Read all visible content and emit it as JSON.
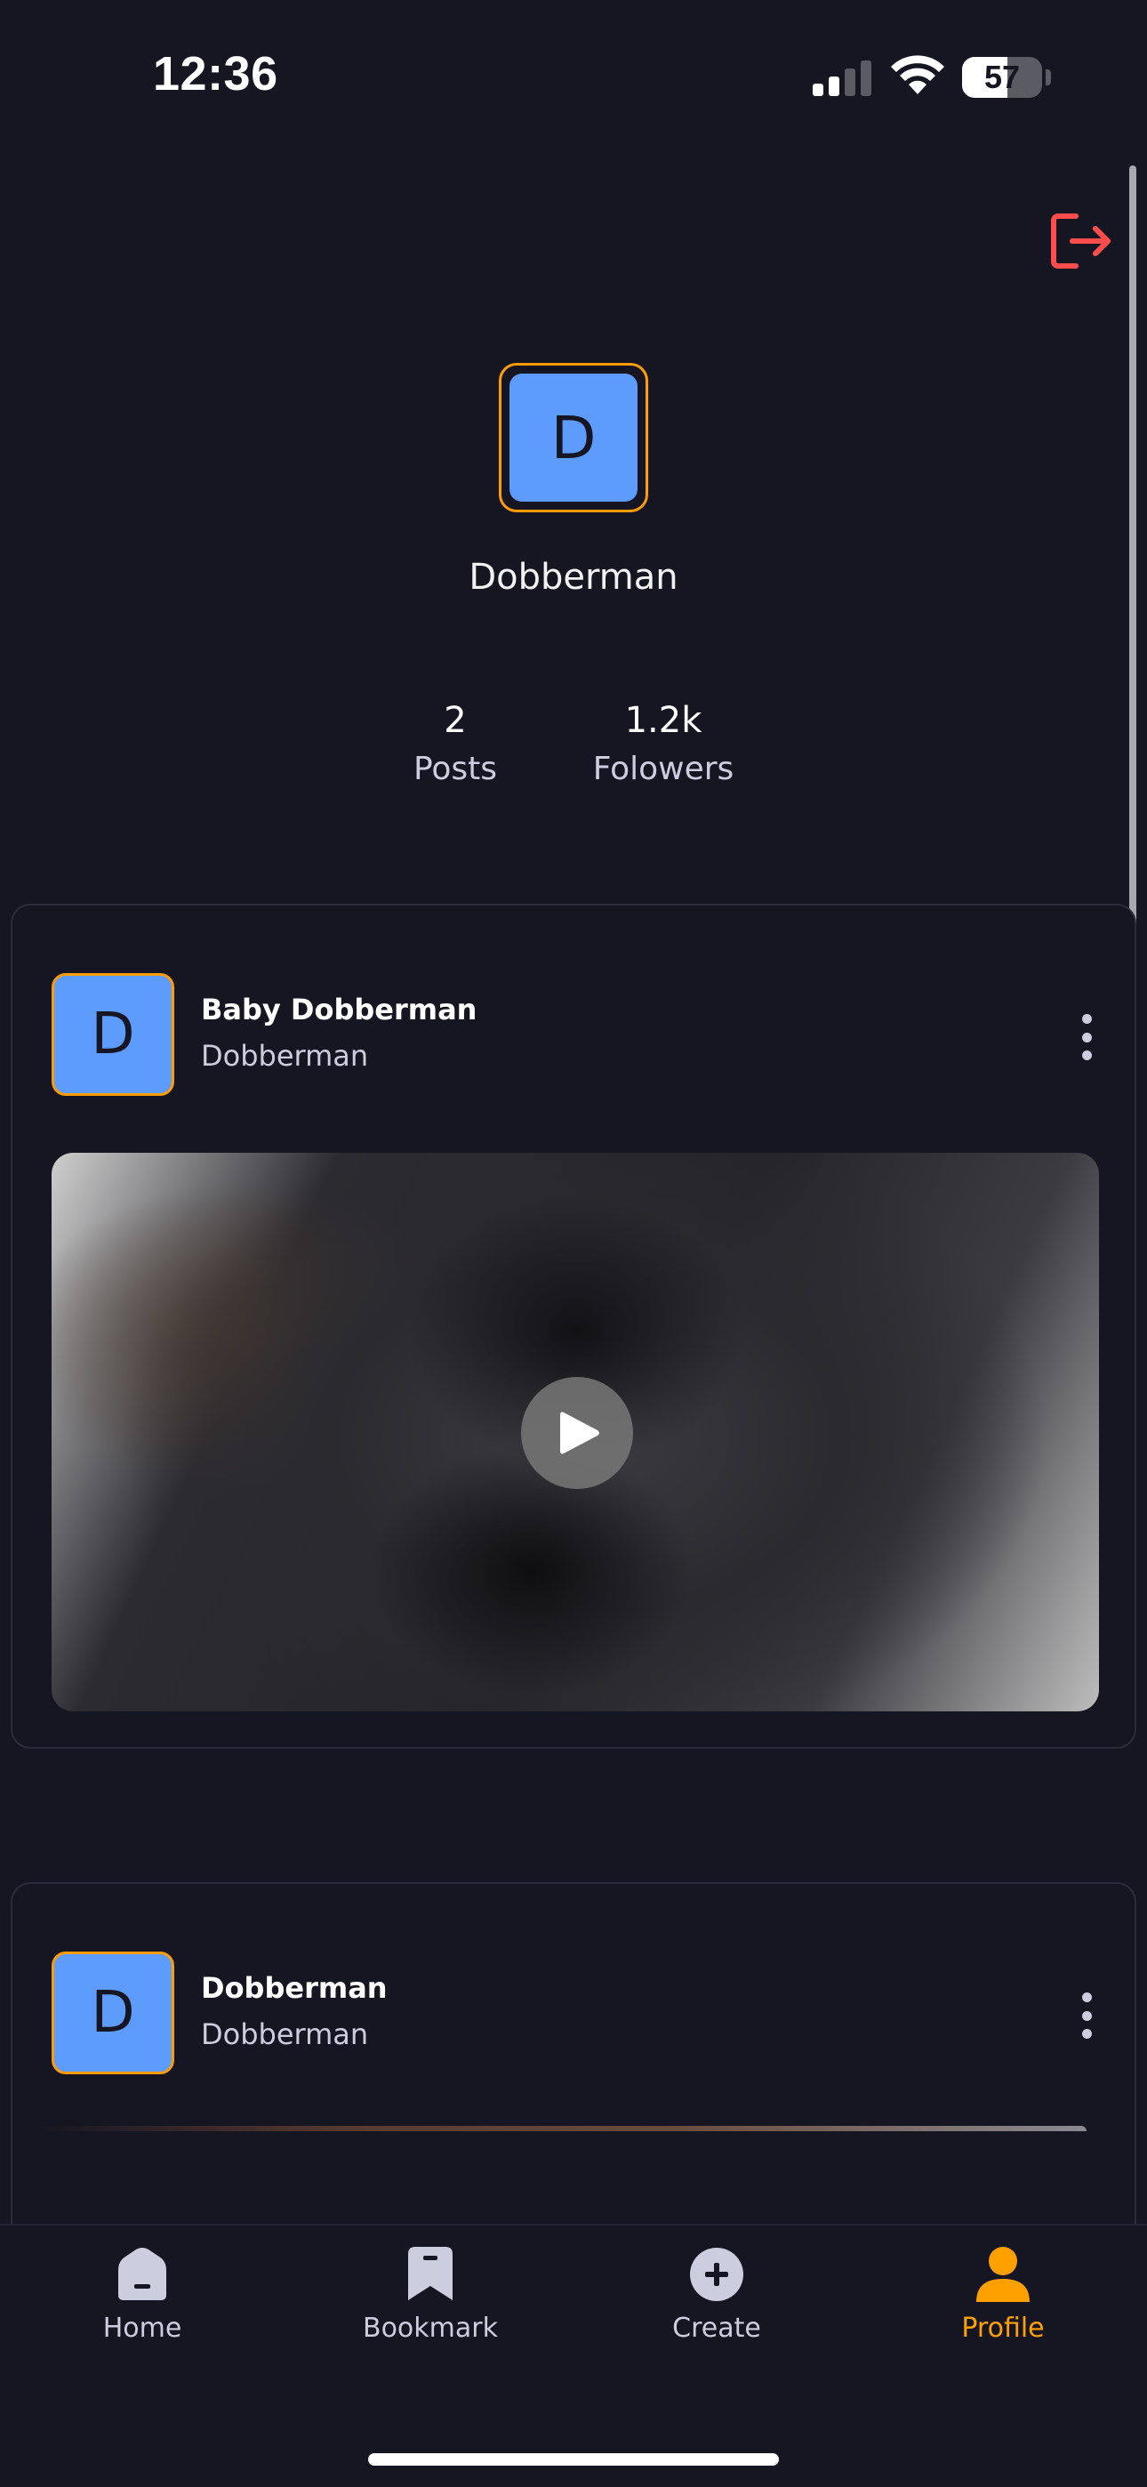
{
  "status_bar": {
    "time": "12:36",
    "battery": "57"
  },
  "profile": {
    "avatar_initial": "D",
    "name": "Dobberman",
    "stats": [
      {
        "value": "2",
        "label": "Posts"
      },
      {
        "value": "1.2k",
        "label": "Folowers"
      }
    ]
  },
  "posts": [
    {
      "avatar_initial": "D",
      "title": "Baby Dobberman",
      "creator": "Dobberman"
    },
    {
      "avatar_initial": "D",
      "title": "Dobberman",
      "creator": "Dobberman"
    }
  ],
  "nav": {
    "tabs": [
      {
        "label": "Home",
        "icon": "home-icon"
      },
      {
        "label": "Bookmark",
        "icon": "bookmark-icon"
      },
      {
        "label": "Create",
        "icon": "plus-icon"
      },
      {
        "label": "Profile",
        "icon": "profile-icon"
      }
    ],
    "active_color": "#FFA001",
    "inactive_color": "#CDCDE0"
  },
  "colors": {
    "background": "#161622",
    "accent": "#FF9C01",
    "avatar": "#5D9BFD",
    "logout": "#FF4D4D"
  }
}
